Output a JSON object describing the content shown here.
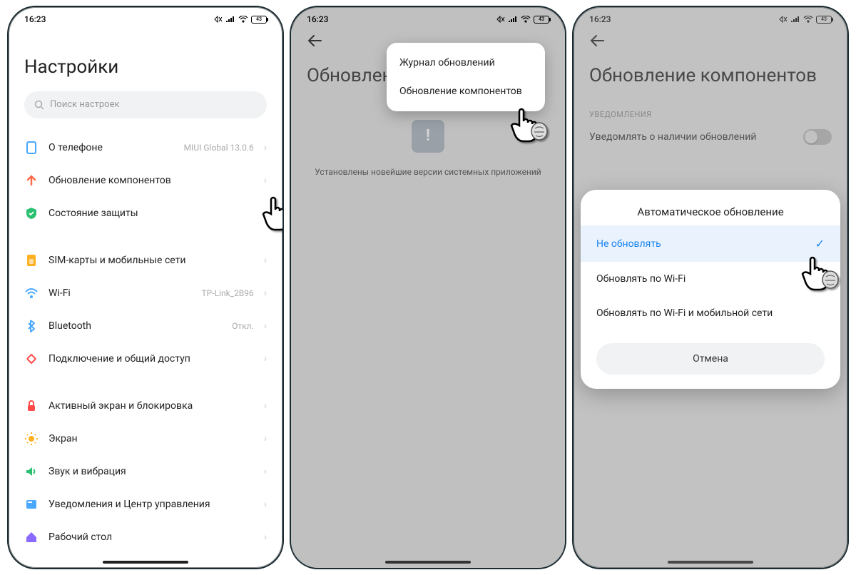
{
  "status": {
    "time": "16:23",
    "battery": "43"
  },
  "screen1": {
    "title": "Настройки",
    "search_placeholder": "Поиск настроек",
    "groups": [
      [
        {
          "icon": "phone",
          "label": "О телефоне",
          "value": "MIUI Global 13.0.6"
        },
        {
          "icon": "up",
          "label": "Обновление компонентов",
          "value": ""
        },
        {
          "icon": "shield",
          "label": "Состояние защиты",
          "value": ""
        }
      ],
      [
        {
          "icon": "sim",
          "label": "SIM-карты и мобильные сети",
          "value": ""
        },
        {
          "icon": "wifi",
          "label": "Wi-Fi",
          "value": "TP-Link_2B96"
        },
        {
          "icon": "bt",
          "label": "Bluetooth",
          "value": "Откл."
        },
        {
          "icon": "share",
          "label": "Подключение и общий доступ",
          "value": ""
        }
      ],
      [
        {
          "icon": "lock",
          "label": "Активный экран и блокировка",
          "value": ""
        },
        {
          "icon": "sun",
          "label": "Экран",
          "value": ""
        },
        {
          "icon": "sound",
          "label": "Звук и вибрация",
          "value": ""
        },
        {
          "icon": "notif",
          "label": "Уведомления и Центр управления",
          "value": ""
        },
        {
          "icon": "home",
          "label": "Рабочий стол",
          "value": ""
        }
      ]
    ]
  },
  "screen2": {
    "title": "Обновлен",
    "message": "Установлены новейшие версии системных приложений",
    "menu": [
      "Журнал обновлений",
      "Обновление компонентов"
    ]
  },
  "screen3": {
    "title": "Обновление компонентов",
    "section": "УВЕДОМЛЕНИЯ",
    "toggle_label": "Уведомлять о наличии обновлений",
    "sheet": {
      "title": "Автоматическое обновление",
      "options": [
        "Не обновлять",
        "Обновлять по Wi-Fi",
        "Обновлять по Wi-Fi и мобильной сети"
      ],
      "selected": 0,
      "cancel": "Отмена"
    }
  }
}
